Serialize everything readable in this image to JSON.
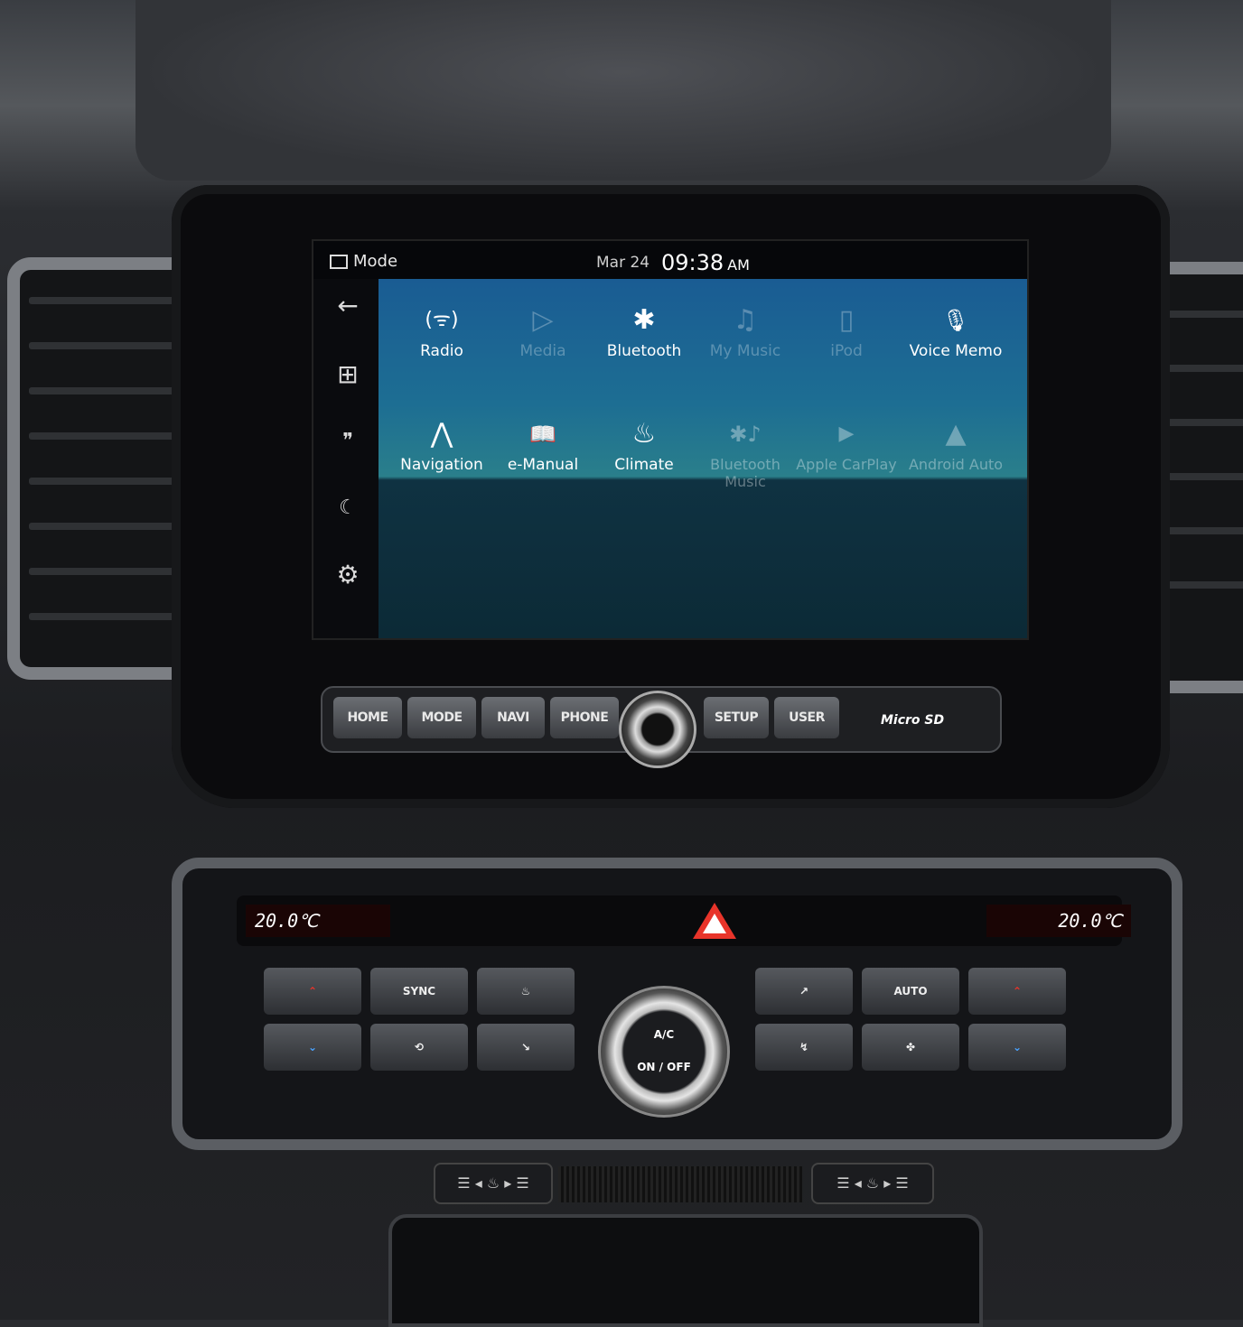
{
  "statusbar": {
    "mode_label": "Mode",
    "date": "Mar 24",
    "time": "09:38",
    "ampm": "AM"
  },
  "sidebar": {
    "items": [
      {
        "name": "back-arrow-icon",
        "glyph": "←"
      },
      {
        "name": "apps-grid-icon",
        "glyph": "⊞"
      },
      {
        "name": "voice-quote-icon",
        "glyph": "❞"
      },
      {
        "name": "screen-off-icon",
        "glyph": "☾"
      },
      {
        "name": "settings-gear-icon",
        "glyph": "⚙"
      }
    ]
  },
  "apps": [
    {
      "label": "Radio",
      "icon": "antenna-icon",
      "glyph": "(ᯤ)",
      "enabled": true
    },
    {
      "label": "Media",
      "icon": "media-play-icon",
      "glyph": "▷",
      "enabled": false
    },
    {
      "label": "Bluetooth",
      "icon": "bluetooth-icon",
      "glyph": "✱",
      "enabled": true
    },
    {
      "label": "My Music",
      "icon": "folder-music-icon",
      "glyph": "♫",
      "enabled": false
    },
    {
      "label": "iPod",
      "icon": "ipod-icon",
      "glyph": "▯",
      "enabled": false
    },
    {
      "label": "Voice Memo",
      "icon": "microphone-icon",
      "glyph": "🎙",
      "enabled": true
    },
    {
      "label": "Navigation",
      "icon": "navigation-arrow-icon",
      "glyph": "⋀",
      "enabled": true
    },
    {
      "label": "e-Manual",
      "icon": "book-icon",
      "glyph": "📖",
      "enabled": true
    },
    {
      "label": "Climate",
      "icon": "seat-airflow-icon",
      "glyph": "♨",
      "enabled": true
    },
    {
      "label": "Bluetooth Music",
      "icon": "bluetooth-music-icon",
      "glyph": "✱♪",
      "enabled": false
    },
    {
      "label": "Apple CarPlay",
      "icon": "carplay-icon",
      "glyph": "▶",
      "enabled": false
    },
    {
      "label": "Android Auto",
      "icon": "android-auto-icon",
      "glyph": "▲",
      "enabled": false
    }
  ],
  "hardware_buttons": [
    "HOME",
    "MODE",
    "NAVI",
    "PHONE",
    "SETUP",
    "USER"
  ],
  "microsd_label": "Micro SD",
  "climate": {
    "left_temp": "20.0℃",
    "right_temp": "20.0℃",
    "sync_label": "SYNC",
    "auto_label": "AUTO",
    "ac_label": "A/C",
    "onoff_label": "ON / OFF"
  },
  "colors": {
    "screen_top": "#1a5c93",
    "screen_bottom": "#0c2a36",
    "hazard": "#e8342a"
  }
}
